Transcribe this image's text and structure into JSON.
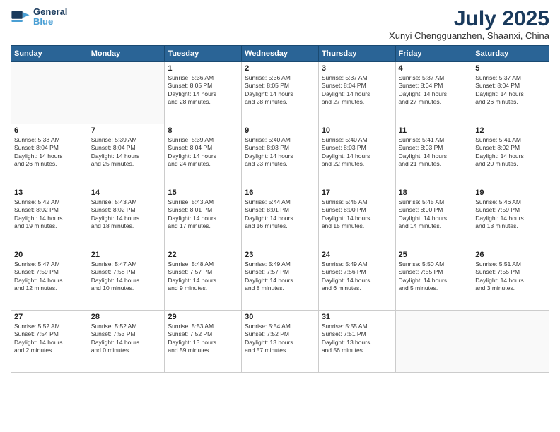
{
  "header": {
    "logo_line1": "General",
    "logo_line2": "Blue",
    "month": "July 2025",
    "location": "Xunyi Chengguanzhen, Shaanxi, China"
  },
  "days_of_week": [
    "Sunday",
    "Monday",
    "Tuesday",
    "Wednesday",
    "Thursday",
    "Friday",
    "Saturday"
  ],
  "weeks": [
    [
      {
        "day": "",
        "info": ""
      },
      {
        "day": "",
        "info": ""
      },
      {
        "day": "1",
        "info": "Sunrise: 5:36 AM\nSunset: 8:05 PM\nDaylight: 14 hours\nand 28 minutes."
      },
      {
        "day": "2",
        "info": "Sunrise: 5:36 AM\nSunset: 8:05 PM\nDaylight: 14 hours\nand 28 minutes."
      },
      {
        "day": "3",
        "info": "Sunrise: 5:37 AM\nSunset: 8:04 PM\nDaylight: 14 hours\nand 27 minutes."
      },
      {
        "day": "4",
        "info": "Sunrise: 5:37 AM\nSunset: 8:04 PM\nDaylight: 14 hours\nand 27 minutes."
      },
      {
        "day": "5",
        "info": "Sunrise: 5:37 AM\nSunset: 8:04 PM\nDaylight: 14 hours\nand 26 minutes."
      }
    ],
    [
      {
        "day": "6",
        "info": "Sunrise: 5:38 AM\nSunset: 8:04 PM\nDaylight: 14 hours\nand 26 minutes."
      },
      {
        "day": "7",
        "info": "Sunrise: 5:39 AM\nSunset: 8:04 PM\nDaylight: 14 hours\nand 25 minutes."
      },
      {
        "day": "8",
        "info": "Sunrise: 5:39 AM\nSunset: 8:04 PM\nDaylight: 14 hours\nand 24 minutes."
      },
      {
        "day": "9",
        "info": "Sunrise: 5:40 AM\nSunset: 8:03 PM\nDaylight: 14 hours\nand 23 minutes."
      },
      {
        "day": "10",
        "info": "Sunrise: 5:40 AM\nSunset: 8:03 PM\nDaylight: 14 hours\nand 22 minutes."
      },
      {
        "day": "11",
        "info": "Sunrise: 5:41 AM\nSunset: 8:03 PM\nDaylight: 14 hours\nand 21 minutes."
      },
      {
        "day": "12",
        "info": "Sunrise: 5:41 AM\nSunset: 8:02 PM\nDaylight: 14 hours\nand 20 minutes."
      }
    ],
    [
      {
        "day": "13",
        "info": "Sunrise: 5:42 AM\nSunset: 8:02 PM\nDaylight: 14 hours\nand 19 minutes."
      },
      {
        "day": "14",
        "info": "Sunrise: 5:43 AM\nSunset: 8:02 PM\nDaylight: 14 hours\nand 18 minutes."
      },
      {
        "day": "15",
        "info": "Sunrise: 5:43 AM\nSunset: 8:01 PM\nDaylight: 14 hours\nand 17 minutes."
      },
      {
        "day": "16",
        "info": "Sunrise: 5:44 AM\nSunset: 8:01 PM\nDaylight: 14 hours\nand 16 minutes."
      },
      {
        "day": "17",
        "info": "Sunrise: 5:45 AM\nSunset: 8:00 PM\nDaylight: 14 hours\nand 15 minutes."
      },
      {
        "day": "18",
        "info": "Sunrise: 5:45 AM\nSunset: 8:00 PM\nDaylight: 14 hours\nand 14 minutes."
      },
      {
        "day": "19",
        "info": "Sunrise: 5:46 AM\nSunset: 7:59 PM\nDaylight: 14 hours\nand 13 minutes."
      }
    ],
    [
      {
        "day": "20",
        "info": "Sunrise: 5:47 AM\nSunset: 7:59 PM\nDaylight: 14 hours\nand 12 minutes."
      },
      {
        "day": "21",
        "info": "Sunrise: 5:47 AM\nSunset: 7:58 PM\nDaylight: 14 hours\nand 10 minutes."
      },
      {
        "day": "22",
        "info": "Sunrise: 5:48 AM\nSunset: 7:57 PM\nDaylight: 14 hours\nand 9 minutes."
      },
      {
        "day": "23",
        "info": "Sunrise: 5:49 AM\nSunset: 7:57 PM\nDaylight: 14 hours\nand 8 minutes."
      },
      {
        "day": "24",
        "info": "Sunrise: 5:49 AM\nSunset: 7:56 PM\nDaylight: 14 hours\nand 6 minutes."
      },
      {
        "day": "25",
        "info": "Sunrise: 5:50 AM\nSunset: 7:55 PM\nDaylight: 14 hours\nand 5 minutes."
      },
      {
        "day": "26",
        "info": "Sunrise: 5:51 AM\nSunset: 7:55 PM\nDaylight: 14 hours\nand 3 minutes."
      }
    ],
    [
      {
        "day": "27",
        "info": "Sunrise: 5:52 AM\nSunset: 7:54 PM\nDaylight: 14 hours\nand 2 minutes."
      },
      {
        "day": "28",
        "info": "Sunrise: 5:52 AM\nSunset: 7:53 PM\nDaylight: 14 hours\nand 0 minutes."
      },
      {
        "day": "29",
        "info": "Sunrise: 5:53 AM\nSunset: 7:52 PM\nDaylight: 13 hours\nand 59 minutes."
      },
      {
        "day": "30",
        "info": "Sunrise: 5:54 AM\nSunset: 7:52 PM\nDaylight: 13 hours\nand 57 minutes."
      },
      {
        "day": "31",
        "info": "Sunrise: 5:55 AM\nSunset: 7:51 PM\nDaylight: 13 hours\nand 56 minutes."
      },
      {
        "day": "",
        "info": ""
      },
      {
        "day": "",
        "info": ""
      }
    ]
  ]
}
